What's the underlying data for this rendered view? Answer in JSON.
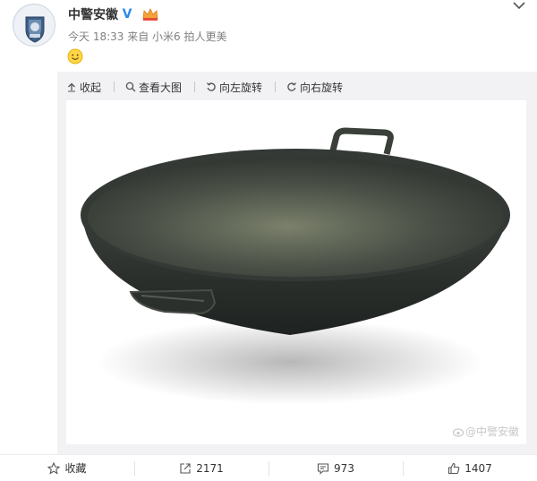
{
  "post": {
    "username": "中警安徽",
    "verified_icon": "verified-v-icon",
    "meta": "今天 18:33 来自 小米6 拍人更美",
    "emoji": "smile-emoji"
  },
  "toolbar": {
    "collapse": "收起",
    "view_large": "查看大图",
    "rotate_left": "向左旋转",
    "rotate_right": "向右旋转"
  },
  "image": {
    "subject": "cast-iron-wok",
    "watermark": "@中警安徽"
  },
  "actions": {
    "favorite": "收藏",
    "repost": "2171",
    "comment": "973",
    "like": "1407"
  },
  "colors": {
    "brand_blue": "#2d8ceb",
    "meta_gray": "#808080",
    "media_bg": "#f2f2f5"
  }
}
